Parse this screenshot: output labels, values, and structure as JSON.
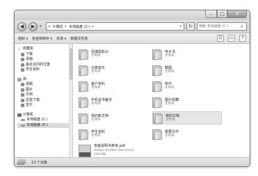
{
  "window": {
    "minimize_glyph": "–",
    "maximize_glyph": "□",
    "close_glyph": "✕"
  },
  "address": {
    "back_glyph": "◀",
    "forward_glyph": "▶",
    "drop_glyph": "▾",
    "segments": [
      "计算机",
      "本地磁盘 (C:)"
    ],
    "chevron": "▸",
    "refresh_glyph": "↻",
    "search_placeholder": "搜索 本地磁盘 (C:)",
    "search_icon": "⌕"
  },
  "toolbar": {
    "organize": "组织 ▾",
    "include_in_library": "包含到库中 ▾",
    "share": "共享 ▾",
    "new_folder": "新建文件夹",
    "view_glyph": "☷",
    "preview_glyph": "▭",
    "help_glyph": "?"
  },
  "navpane": {
    "favorites": {
      "label": "收藏夹",
      "items": [
        "下载",
        "桌面",
        "最近访问的位置",
        "学生资料"
      ]
    },
    "libraries": {
      "label": "库",
      "items": [
        "视频",
        "图片",
        "文档",
        "迅雷下载",
        "音乐"
      ]
    },
    "computer": {
      "label": "计算机",
      "items": [
        "本地磁盘 (C:)",
        "本地磁盘 (D:)"
      ]
    }
  },
  "files": [
    {
      "name": "迅捷投影仪",
      "type": "文件夹"
    },
    {
      "name": "电子书",
      "type": "文件夹"
    },
    {
      "name": "古典音乐",
      "type": "文件夹"
    },
    {
      "name": "截图",
      "type": "文件夹"
    },
    {
      "name": "客户资料",
      "type": "文件夹"
    },
    {
      "name": "软件",
      "type": "文件夹"
    },
    {
      "name": "手机证书备份",
      "type": "文件夹"
    },
    {
      "name": "图片收藏",
      "type": "文件夹"
    },
    {
      "name": "我的新文档",
      "type": "文件夹"
    },
    {
      "name": "我的文档",
      "type": "文件夹"
    },
    {
      "name": "学生资料",
      "type": "文件夹"
    },
    {
      "name": "重要文件",
      "type": "文件夹"
    }
  ],
  "pdf": {
    "name": "安装说明书参考.pdf",
    "type": "Adobe Acrobat Document",
    "size": "100 MB"
  },
  "status": {
    "count": "13 个对象"
  }
}
